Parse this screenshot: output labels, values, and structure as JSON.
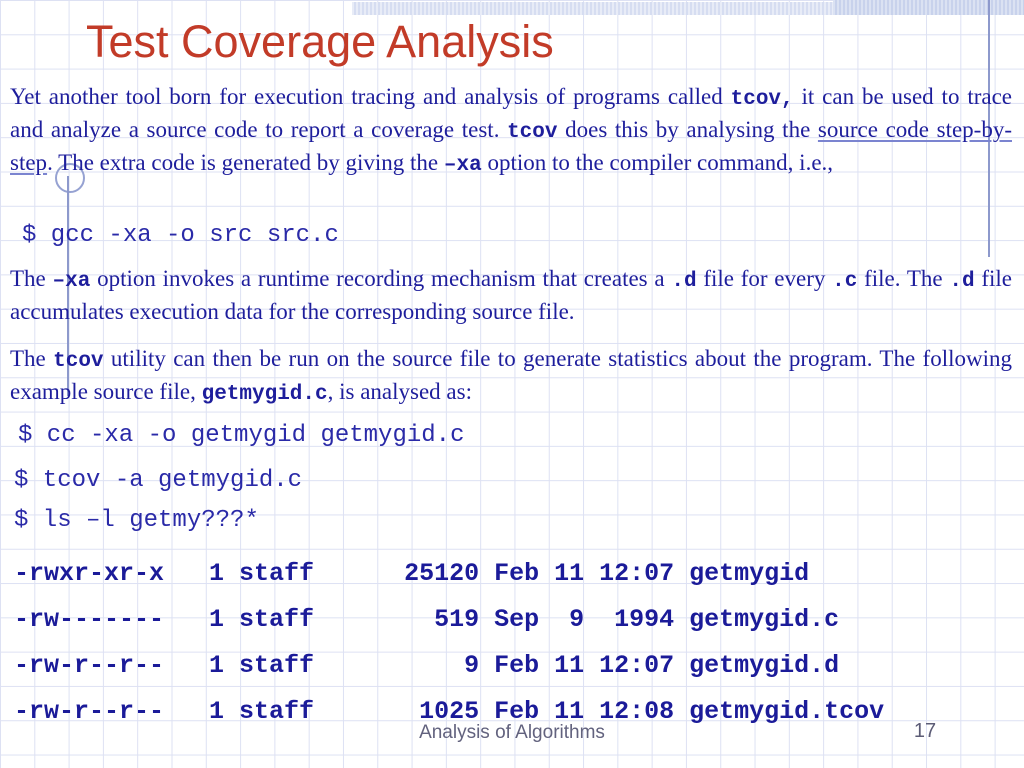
{
  "slide": {
    "title": "Test Coverage Analysis",
    "footer": "Analysis of Algorithms",
    "page_number": "17"
  },
  "colors": {
    "title_red": "#c23b28",
    "body_navy": "#1e1e9c",
    "code_navy": "#2a2aa8",
    "listing_navy": "#1b1b99",
    "footer_gray": "#62627e",
    "grid_line": "#dde1f3",
    "band_blue": "#d6ddf1",
    "band_corner_blue": "#c8d2ec",
    "decor_line_blue": "#8d99cc"
  },
  "decorations": {
    "circle": "circle-outline",
    "left_line": "vertical-connector-line",
    "right_line": "vertical-rule",
    "bands": "header-highlight-bands"
  },
  "paragraphs": {
    "p1": [
      {
        "t": "Yet another tool born for execution tracing and analysis of programs called ",
        "s": ""
      },
      {
        "t": "tcov,",
        "s": "m"
      },
      {
        "t": " it can be used to trace and analyze a source code to report a coverage test. ",
        "s": ""
      },
      {
        "t": "tcov",
        "s": "m"
      },
      {
        "t": " does this by analysing the ",
        "s": ""
      },
      {
        "t": "source code step-by-step",
        "s": "u"
      },
      {
        "t": ". The extra code is generated by giving the ",
        "s": ""
      },
      {
        "t": "–xa",
        "s": "m"
      },
      {
        "t": "  option to the compiler command, i.e.,",
        "s": ""
      }
    ],
    "p2": [
      {
        "t": "The ",
        "s": ""
      },
      {
        "t": "–xa",
        "s": "m"
      },
      {
        "t": " option invokes a runtime recording mechanism that creates a ",
        "s": ""
      },
      {
        "t": ".d",
        "s": "m"
      },
      {
        "t": " file for every ",
        "s": ""
      },
      {
        "t": ".c",
        "s": "m"
      },
      {
        "t": " file. The ",
        "s": ""
      },
      {
        "t": ".d",
        "s": "m"
      },
      {
        "t": "  file accumulates execution data for the corresponding source file.",
        "s": ""
      }
    ],
    "p3": [
      {
        "t": "The ",
        "s": ""
      },
      {
        "t": "tcov",
        "s": "m"
      },
      {
        "t": " utility can then be run on the source file to generate statistics about the program. The following example source file, ",
        "s": ""
      },
      {
        "t": "getmygid.c",
        "s": "m"
      },
      {
        "t": ", is analysed as:",
        "s": ""
      }
    ]
  },
  "code_lines": [
    "$ gcc -xa -o src src.c",
    "$ cc -xa -o getmygid getmygid.c",
    "$ tcov -a getmygid.c",
    "$ ls –l getmy???*"
  ],
  "listing_lines": [
    "-rwxr-xr-x   1 staff      25120 Feb 11 12:07 getmygid",
    "-rw-------   1 staff        519 Sep  9  1994 getmygid.c",
    "-rw-r--r--   1 staff          9 Feb 11 12:07 getmygid.d",
    "-rw-r--r--   1 staff       1025 Feb 11 12:08 getmygid.tcov"
  ]
}
